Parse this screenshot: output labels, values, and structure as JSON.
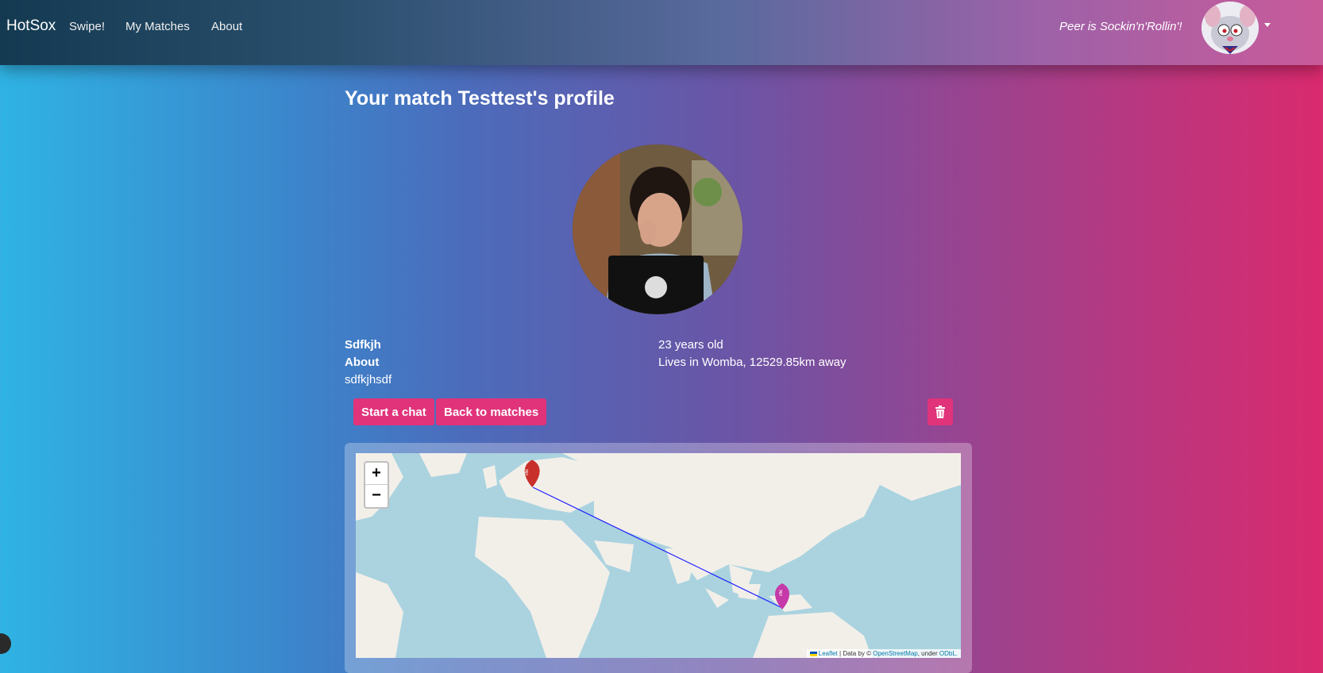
{
  "nav": {
    "brand": "HotSox",
    "links": [
      "Swipe!",
      "My Matches",
      "About"
    ],
    "status": "Peer is Sockin'n'Rollin'!",
    "avatar_icon": "pinky-cartoon-avatar"
  },
  "page": {
    "title": "Your match Testtest's profile"
  },
  "profile": {
    "name": "Sdfkjh",
    "about_label": "About",
    "about_text": "sdfkjhsdf",
    "age": "23 years old",
    "location": "Lives in Womba, 12529.85km away"
  },
  "actions": {
    "start_chat": "Start a chat",
    "back": "Back to matches",
    "delete_icon": "trash-icon"
  },
  "map": {
    "zoom_in": "+",
    "zoom_out": "−",
    "attribution": {
      "leaflet": "Leaflet",
      "data_prefix": "| Data by ©",
      "osm": "OpenStreetMap",
      "under": ", under",
      "odbl": "ODbL."
    },
    "markers": [
      {
        "name": "user-location-marker",
        "color": "#c8302b",
        "icon": "sock-icon"
      },
      {
        "name": "match-location-marker",
        "color": "#c53aa8",
        "icon": "sock-icon"
      }
    ],
    "line_color": "#2222ff"
  },
  "colors": {
    "accent": "#e0337a"
  }
}
